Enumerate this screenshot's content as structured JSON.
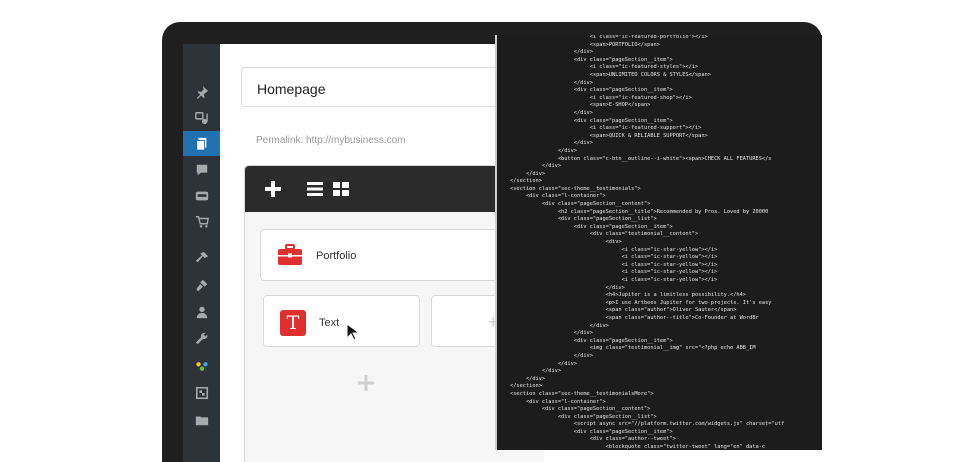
{
  "sidebar": {
    "items": [
      {
        "icon": "pin-icon",
        "active": false
      },
      {
        "icon": "media-icon",
        "active": false
      },
      {
        "icon": "pages-icon",
        "active": true
      },
      {
        "icon": "comments-icon",
        "active": false
      },
      {
        "icon": "woocommerce-icon",
        "active": false
      },
      {
        "icon": "cart-icon",
        "active": false
      },
      {
        "icon": "appearance-icon",
        "active": false
      },
      {
        "icon": "plugins-icon",
        "active": false
      },
      {
        "icon": "users-icon",
        "active": false
      },
      {
        "icon": "tools-icon",
        "active": false
      },
      {
        "icon": "jupiter-icon",
        "active": false
      },
      {
        "icon": "settings-icon",
        "active": false
      },
      {
        "icon": "folder-icon",
        "active": false
      }
    ]
  },
  "editor": {
    "title_value": "Homepage",
    "permalink": "Permalink: http://mybusiness.com"
  },
  "builder": {
    "toolbar_icons": [
      "plus-icon",
      "list-view-icon",
      "grid-view-icon"
    ],
    "blocks": [
      {
        "label": "Portfolio",
        "icon": "briefcase-icon"
      },
      {
        "label": "Text",
        "icon": "text-t-icon",
        "icon_glyph": "T"
      }
    ],
    "add_glyph": "+"
  },
  "colors": {
    "accent_blue": "#2271b1",
    "block_red": "#e02f2f",
    "toolbar_dark": "#2b2b2b",
    "code_bg": "#1c1c1c"
  },
  "code": {
    "lines": [
      "                         <i class=\"ic-featured-portfolio\"></i>",
      "                         <span>PORTFOLIO</span>",
      "                    </div>",
      "                    <div class=\"pageSection__item\">",
      "                         <i class=\"ic-featured-styles\"></i>",
      "                         <span>UNLIMITED COLORS & STYLES</span>",
      "                    </div>",
      "                    <div class=\"pageSection__item\">",
      "                         <i class=\"ic-featured-shop\"></i>",
      "                         <span>E-SHOP</span>",
      "                    </div>",
      "                    <div class=\"pageSection__item\">",
      "                         <i class=\"ic-featured-support\"></i>",
      "                         <span>QUICK & RELIABLE SUPPORT</span>",
      "                    </div>",
      "               </div>",
      "               <button class=\"c-btn__outline--i-white\"><span>CHECK ALL FEATURES</s",
      "          </div>",
      "     </div>",
      "</section>",
      "<section class=\"sec-theme__testimonials\">",
      "     <div class=\"l-container\">",
      "          <div class=\"pageSection__content\">",
      "               <h2 class=\"pageSection__title\">Recommended by Pros. Loved by 20000",
      "               <div class=\"pageSection__list\">",
      "                    <div class=\"pageSection__item\">",
      "                         <div class=\"testimonial__content\">",
      "                              <div>",
      "                                   <i class=\"ic-star-yellow\"></i>",
      "                                   <i class=\"ic-star-yellow\"></i>",
      "                                   <i class=\"ic-star-yellow\"></i>",
      "                                   <i class=\"ic-star-yellow\"></i>",
      "                                   <i class=\"ic-star-yellow\"></i>",
      "                              </div>",
      "                              <h4>Jupiter is a limitless possibility.</h4>",
      "                              <p>I use Artbees Jupiter for two projects. It's easy",
      "                              <span class=\"author\">Oliver Sauter</span>",
      "                              <span class=\"author--title\">Co-Founder at WordBr",
      "                         </div>",
      "                    </div>",
      "                    <div class=\"pageSection__item\">",
      "                         <img class=\"testimonial__img\" src=\"<?php echo ABB_IM",
      "                    </div>",
      "               </div>",
      "          </div>",
      "     </div>",
      "</section>",
      "<section class=\"sec-theme__testimonialsMore\">",
      "     <div class=\"l-container\">",
      "          <div class=\"pageSection__content\">",
      "               <div class=\"pageSection__list\">",
      "                    <script async src=\"//platform.twitter.com/widgets.js\" charset=\"utf",
      "                    <div class=\"pageSection__item\">",
      "                         <div class=\"author--tweet\">",
      "                              <blockquote class=\"twitter-tweet\" lang=\"en\" data-c"
    ]
  }
}
